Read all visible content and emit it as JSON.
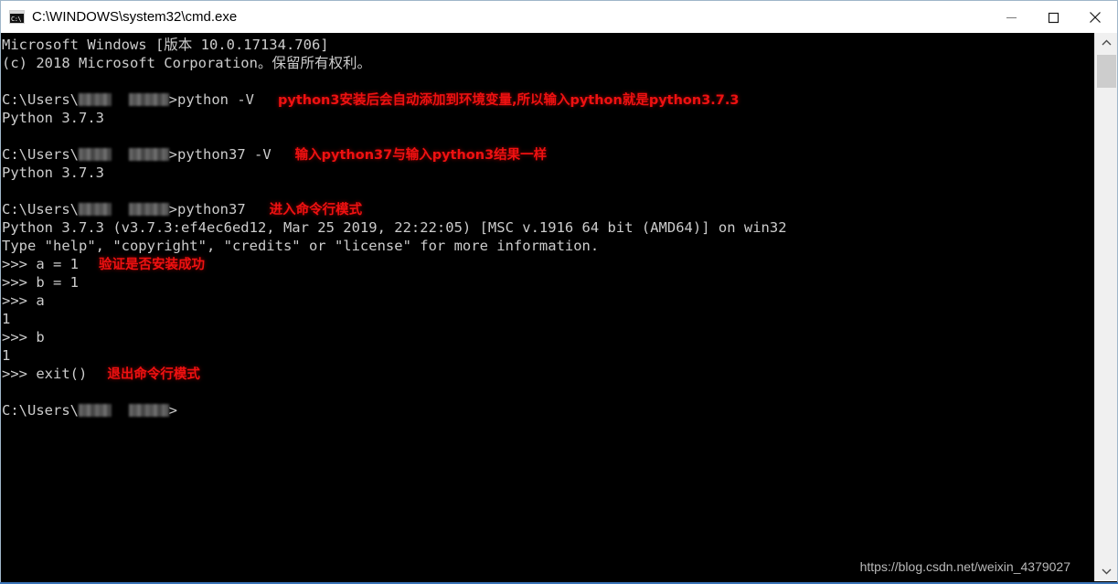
{
  "window": {
    "title": "C:\\WINDOWS\\system32\\cmd.exe",
    "icon": "cmd-console-icon",
    "icon_glyph": "C:\\",
    "controls": {
      "minimize": "minimize-button",
      "maximize": "maximize-button",
      "close": "close-button"
    },
    "colors": {
      "titlebar_bg": "#ffffff",
      "console_bg": "#000000",
      "console_fg": "#cccccc",
      "annotation_red": "#ee1111",
      "border_blue": "#3b74b8",
      "scrollbar_track": "#f0f0f0",
      "scrollbar_thumb": "#cdcdcd"
    }
  },
  "terminal": {
    "lines": [
      {
        "type": "text",
        "text": "Microsoft Windows [版本 10.0.17134.706]"
      },
      {
        "type": "text",
        "text": "(c) 2018 Microsoft Corporation。保留所有权利。"
      },
      {
        "type": "blank"
      },
      {
        "type": "prompt",
        "prefix": "C:\\Users\\",
        "suffix": ">python -V",
        "note": "python3安装后会自动添加到环境变量,所以输入python就是python3.7.3"
      },
      {
        "type": "text",
        "text": "Python 3.7.3"
      },
      {
        "type": "blank"
      },
      {
        "type": "prompt",
        "prefix": "C:\\Users\\",
        "suffix": ">python37 -V",
        "note": "输入python37与输入python3结果一样"
      },
      {
        "type": "text",
        "text": "Python 3.7.3"
      },
      {
        "type": "blank"
      },
      {
        "type": "prompt",
        "prefix": "C:\\Users\\",
        "suffix": ">python37",
        "note": "进入命令行模式"
      },
      {
        "type": "text",
        "text": "Python 3.7.3 (v3.7.3:ef4ec6ed12, Mar 25 2019, 22:22:05) [MSC v.1916 64 bit (AMD64)] on win32"
      },
      {
        "type": "text",
        "text": "Type \"help\", \"copyright\", \"credits\" or \"license\" for more information."
      },
      {
        "type": "text",
        "text": ">>> a = 1",
        "note": "验证是否安装成功"
      },
      {
        "type": "text",
        "text": ">>> b = 1"
      },
      {
        "type": "text",
        "text": ">>> a"
      },
      {
        "type": "text",
        "text": "1"
      },
      {
        "type": "text",
        "text": ">>> b"
      },
      {
        "type": "text",
        "text": "1"
      },
      {
        "type": "text",
        "text": ">>> exit()",
        "note": "退出命令行模式"
      },
      {
        "type": "blank"
      },
      {
        "type": "prompt",
        "prefix": "C:\\Users\\",
        "suffix": ">"
      }
    ]
  },
  "watermark": {
    "text": "https://blog.csdn.net/weixin_4379027"
  },
  "scrollbar": {
    "up_arrow": "scroll-up-arrow",
    "down_arrow": "scroll-down-arrow",
    "thumb": "scroll-thumb"
  }
}
